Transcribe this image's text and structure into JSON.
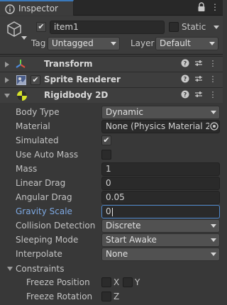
{
  "tab": {
    "label": "Inspector"
  },
  "object": {
    "name": "item1",
    "active": true,
    "static_label": "Static",
    "static": false,
    "tag_label": "Tag",
    "tag_value": "Untagged",
    "layer_label": "Layer",
    "layer_value": "Default"
  },
  "components": [
    {
      "name": "Transform"
    },
    {
      "name": "Sprite Renderer",
      "enabled": true
    },
    {
      "name": "Rigidbody 2D"
    }
  ],
  "rigidbody": {
    "body_type": {
      "label": "Body Type",
      "value": "Dynamic"
    },
    "material": {
      "label": "Material",
      "value": "None (Physics Material 2D)"
    },
    "simulated": {
      "label": "Simulated",
      "checked": true
    },
    "use_auto_mass": {
      "label": "Use Auto Mass",
      "checked": false
    },
    "mass": {
      "label": "Mass",
      "value": "1"
    },
    "linear_drag": {
      "label": "Linear Drag",
      "value": "0"
    },
    "angular_drag": {
      "label": "Angular Drag",
      "value": "0.05"
    },
    "gravity_scale": {
      "label": "Gravity Scale",
      "value": "0"
    },
    "collision_detection": {
      "label": "Collision Detection",
      "value": "Discrete"
    },
    "sleeping_mode": {
      "label": "Sleeping Mode",
      "value": "Start Awake"
    },
    "interpolate": {
      "label": "Interpolate",
      "value": "None"
    },
    "constraints": {
      "label": "Constraints",
      "freeze_position": {
        "label": "Freeze Position",
        "x_label": "X",
        "y_label": "Y"
      },
      "freeze_rotation": {
        "label": "Freeze Rotation",
        "z_label": "Z"
      }
    }
  },
  "colors": {
    "accent": "#3a79bb",
    "highlight_label": "#7ea9e3",
    "focus_border": "#4d86c9"
  }
}
